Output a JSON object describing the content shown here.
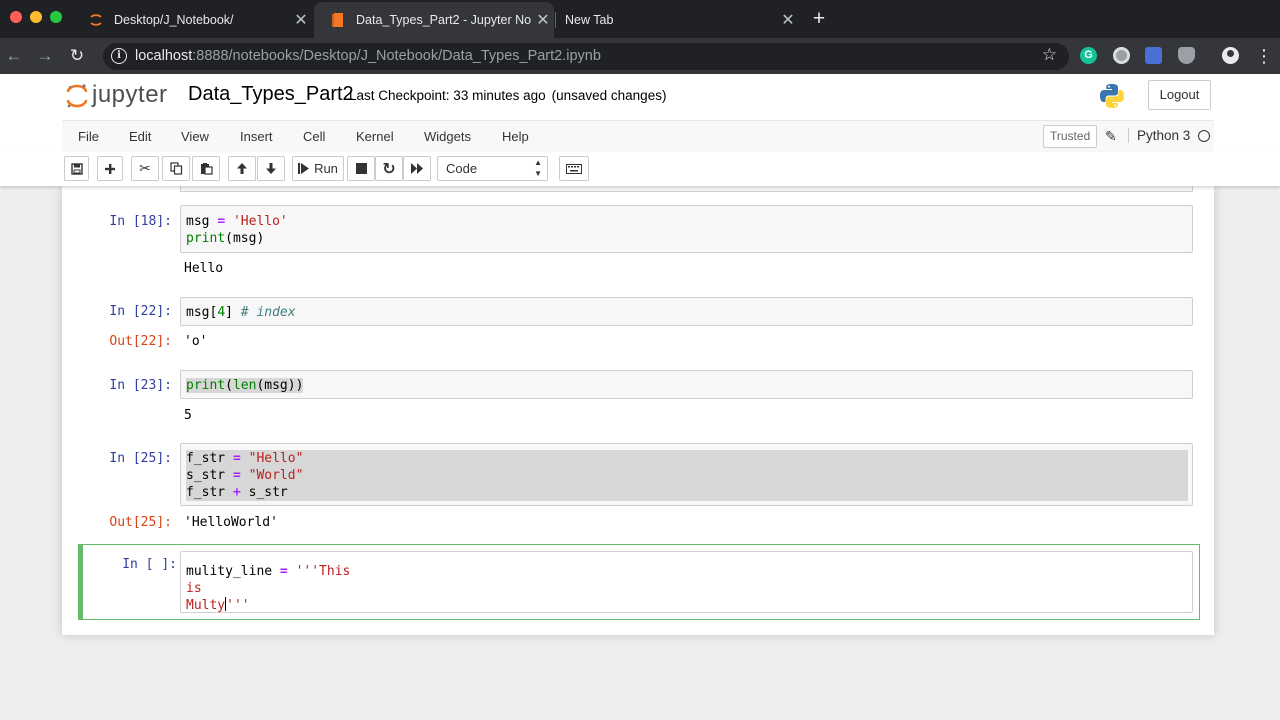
{
  "browser": {
    "tabs": [
      {
        "title": "Desktop/J_Notebook/",
        "active": false
      },
      {
        "title": "Data_Types_Part2 - Jupyter No",
        "active": true
      },
      {
        "title": "New Tab",
        "active": false
      }
    ],
    "url_host": "localhost",
    "url_path": ":8888/notebooks/Desktop/J_Notebook/Data_Types_Part2.ipynb"
  },
  "header": {
    "logo_text": "jupyter",
    "notebook_name": "Data_Types_Part2",
    "checkpoint": "Last Checkpoint: 33 minutes ago",
    "unsaved": "(unsaved changes)",
    "logout_label": "Logout"
  },
  "menubar": {
    "items": [
      "File",
      "Edit",
      "View",
      "Insert",
      "Cell",
      "Kernel",
      "Widgets",
      "Help"
    ],
    "trusted": "Trusted",
    "kernel_name": "Python 3"
  },
  "toolbar": {
    "run_label": "Run",
    "cell_type": "Code"
  },
  "cells": [
    {
      "prompt": "In [18]:",
      "code": [
        "msg = 'Hello'",
        "print(msg)"
      ],
      "output": "Hello",
      "out_prompt": ""
    },
    {
      "prompt": "In [22]:",
      "code": [
        "msg[4] # index"
      ],
      "output": "'o'",
      "out_prompt": "Out[22]:"
    },
    {
      "prompt": "In [23]:",
      "code": [
        "print(len(msg))"
      ],
      "output": "5",
      "out_prompt": ""
    },
    {
      "prompt": "In [25]:",
      "code": [
        "f_str = \"Hello\"",
        "s_str = \"World\"",
        "f_str + s_str"
      ],
      "output": "'HelloWorld'",
      "out_prompt": "Out[25]:"
    },
    {
      "prompt": "In [ ]:",
      "code": [
        "mulity_line = '''This",
        "is",
        "Multy'''"
      ],
      "output": "",
      "out_prompt": ""
    }
  ],
  "colors": {
    "in_prompt": "#303f9f",
    "out_prompt": "#d84315",
    "edit_border": "#66bb6a",
    "string": "#ba2121",
    "operator": "#aa22ff",
    "builtin": "#008000"
  }
}
